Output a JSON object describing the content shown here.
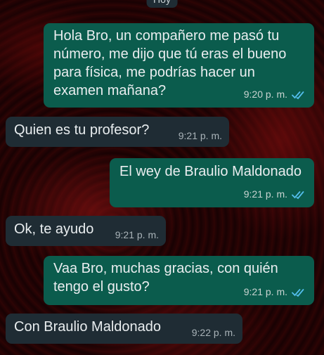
{
  "chat": {
    "date_label": "Hoy",
    "messages": [
      {
        "direction": "out",
        "text": "Hola Bro, un compañero me pasó tu número, me dijo que tú eras el bueno para física, me podrías hacer un examen mañana?",
        "time": "9:20 p. m.",
        "status": "read"
      },
      {
        "direction": "in",
        "text": "Quien es tu profesor?",
        "time": "9:21 p. m."
      },
      {
        "direction": "out",
        "text": "El wey de Braulio Maldonado",
        "time": "9:21 p. m.",
        "status": "read"
      },
      {
        "direction": "in",
        "text": "Ok, te ayudo",
        "time": "9:21 p. m."
      },
      {
        "direction": "out",
        "text": "Vaa Bro, muchas gracias, con quién tengo el gusto?",
        "time": "9:21 p. m.",
        "status": "read"
      },
      {
        "direction": "in",
        "text": "Con Braulio Maldonado",
        "time": "9:22 p. m."
      }
    ]
  },
  "colors": {
    "outgoing_bubble": "#0b5c4d",
    "incoming_bubble": "#1f2c34",
    "read_ticks": "#53bdeb"
  },
  "icons": {
    "read_receipt": "double-check-icon"
  }
}
